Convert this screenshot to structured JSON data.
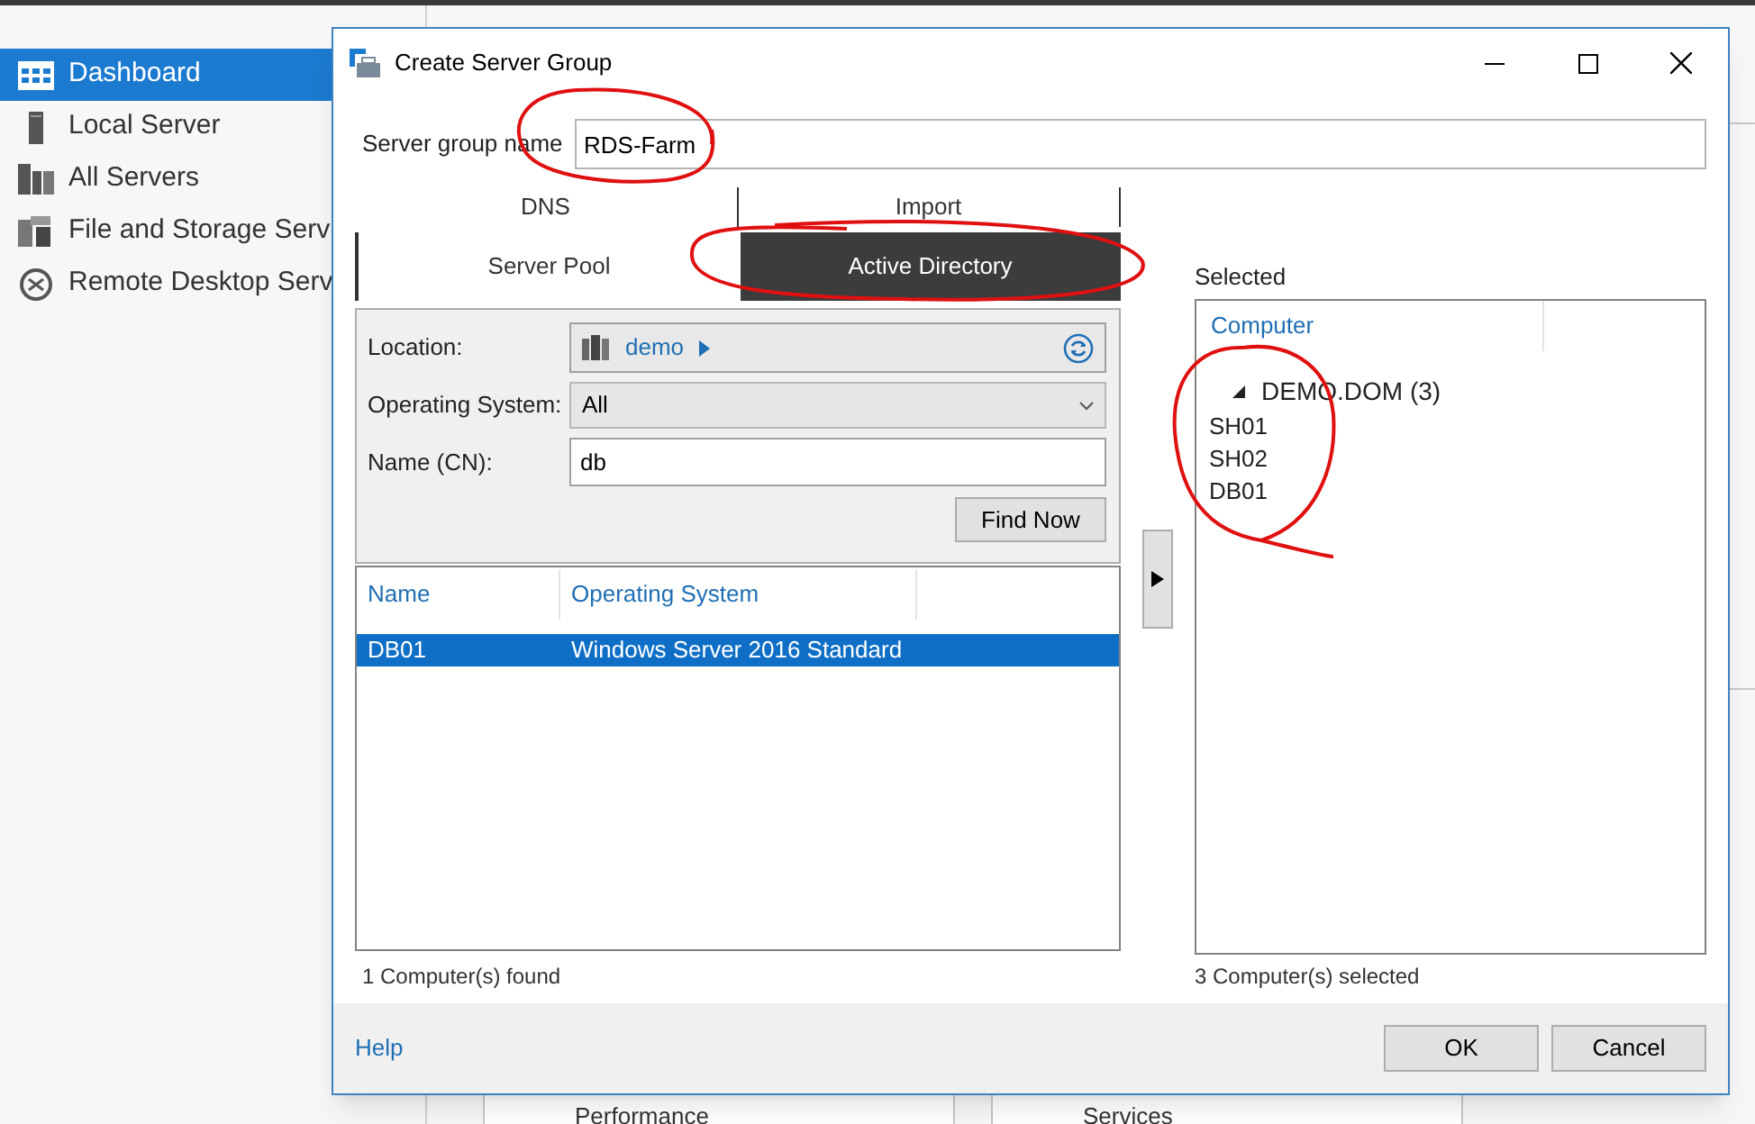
{
  "sidebar": {
    "items": [
      {
        "label": "Dashboard",
        "selected": true
      },
      {
        "label": "Local Server",
        "selected": false
      },
      {
        "label": "All Servers",
        "selected": false
      },
      {
        "label": "File and Storage Serv",
        "selected": false
      },
      {
        "label": "Remote Desktop Serv",
        "selected": false
      }
    ]
  },
  "background_tiles": [
    "Performance",
    "Services"
  ],
  "dialog": {
    "title": "Create Server Group",
    "name_field": {
      "label": "Server group name",
      "value": "RDS-Farm"
    },
    "tabs": [
      {
        "label": "DNS",
        "selected": false
      },
      {
        "label": "Import",
        "selected": false
      },
      {
        "label": "Server Pool",
        "selected": false
      },
      {
        "label": "Active Directory",
        "selected": true
      }
    ],
    "search": {
      "location": {
        "label": "Location:",
        "value": "demo"
      },
      "operating_system": {
        "label": "Operating System:",
        "value": "All"
      },
      "name": {
        "label": "Name (CN):",
        "value": "db"
      },
      "find_button": "Find Now"
    },
    "results": {
      "columns": [
        "Name",
        "Operating System"
      ],
      "rows": [
        {
          "cells": [
            "DB01",
            "Windows Server 2016 Standard"
          ],
          "selected": true
        }
      ],
      "status": "1 Computer(s) found"
    },
    "selected": {
      "label": "Selected",
      "column": "Computer",
      "tree": [
        {
          "label": "DEMO.DOM (3)",
          "expanded": true,
          "children": [
            {
              "label": "SH01"
            },
            {
              "label": "SH02"
            },
            {
              "label": "DB01"
            }
          ]
        }
      ],
      "status": "3 Computer(s) selected"
    },
    "help_link": "Help",
    "buttons": [
      "OK",
      "Cancel"
    ]
  }
}
